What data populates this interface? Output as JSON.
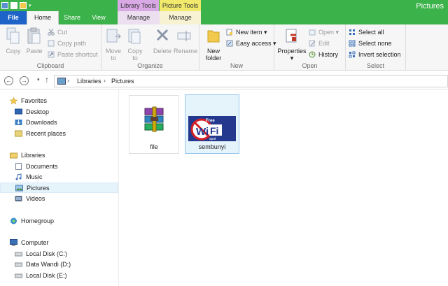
{
  "window": {
    "title": "Pictures"
  },
  "context_tabs": {
    "library_tools": "Library Tools",
    "picture_tools": "Picture Tools"
  },
  "tabs": {
    "file": "File",
    "home": "Home",
    "share": "Share",
    "view": "View",
    "manage_library": "Manage",
    "manage_picture": "Manage"
  },
  "ribbon": {
    "clipboard": {
      "label": "Clipboard",
      "copy": "Copy",
      "paste": "Paste",
      "cut": "Cut",
      "copy_path": "Copy path",
      "paste_shortcut": "Paste shortcut"
    },
    "organize": {
      "label": "Organize",
      "move_to": "Move",
      "move_to2": "to",
      "copy_to": "Copy",
      "copy_to2": "to",
      "delete": "Delete",
      "rename": "Rename"
    },
    "new": {
      "label": "New",
      "new_folder": "New",
      "new_folder2": "folder",
      "new_item": "New item",
      "easy_access": "Easy access"
    },
    "open": {
      "label": "Open",
      "properties": "Properties",
      "open": "Open",
      "edit": "Edit",
      "history": "History"
    },
    "select": {
      "label": "Select",
      "select_all": "Select all",
      "select_none": "Select none",
      "invert_selection": "Invert selection"
    }
  },
  "address": {
    "root": "Libraries",
    "current": "Pictures"
  },
  "nav": {
    "favorites": "Favorites",
    "desktop": "Desktop",
    "downloads": "Downloads",
    "recent_places": "Recent places",
    "libraries": "Libraries",
    "documents": "Documents",
    "music": "Music",
    "pictures": "Pictures",
    "videos": "Videos",
    "homegroup": "Homegroup",
    "computer": "Computer",
    "local_disk_c": "Local Disk (C:)",
    "data_wandi_d": "Data Wandi (D:)",
    "local_disk_e": "Local Disk (E:)"
  },
  "files": [
    {
      "name": "file",
      "icon": "winrar-archive-icon"
    },
    {
      "name": "sembunyi",
      "icon": "free-wifi-image"
    }
  ],
  "wifi_image": {
    "free": "Free",
    "wi": "Wi",
    "fi": "Fi",
    "spot": "spot"
  },
  "colors": {
    "accent_green": "#3cb24a",
    "file_tab": "#1e64c8",
    "library_tools": "#d9a9e6",
    "picture_tools": "#f0e96b",
    "selection": "#e5f3fb"
  }
}
